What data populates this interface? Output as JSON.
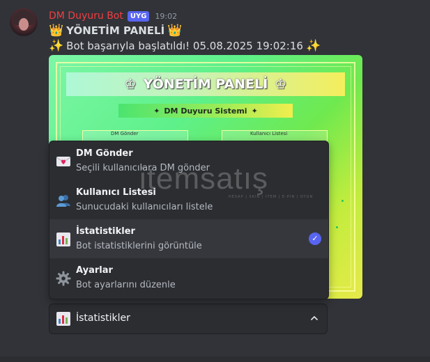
{
  "message": {
    "username": "DM Duyuru Bot",
    "badge": "UYG",
    "timestamp": "19:02",
    "line1": "YÖNETİM PANELİ",
    "line2": "Bot başarıyla başlatıldı! 05.08.2025 19:02:16"
  },
  "embed_image": {
    "title": "YÖNETİM PANELİ",
    "subtitle": "DM Duyuru Sistemi",
    "box_left": "DM Gönder",
    "box_right": "Kullanıcı Listesi"
  },
  "menu": {
    "options": [
      {
        "label": "DM Gönder",
        "description": "Seçili kullanıcılara DM gönder",
        "icon": "love-letter-icon",
        "selected": false
      },
      {
        "label": "Kullanıcı Listesi",
        "description": "Sunucudaki kullanıcıları listele",
        "icon": "users-icon",
        "selected": false
      },
      {
        "label": "İstatistikler",
        "description": "Bot istatistiklerini görüntüle",
        "icon": "bar-chart-icon",
        "selected": true
      },
      {
        "label": "Ayarlar",
        "description": "Bot ayarlarını düzenle",
        "icon": "gear-icon",
        "selected": false
      }
    ]
  },
  "select": {
    "value": "İstatistikler",
    "icon": "bar-chart-icon"
  },
  "watermark": {
    "text": "itemsatış",
    "sub": "HESAP | SKIN | ITEM | E-PIN | OYUN"
  },
  "colors": {
    "background": "#313338",
    "username": "#f23f43",
    "badge": "#5865f2",
    "menu_bg": "#2b2d31",
    "selected_bg": "#36373d",
    "check": "#5865f2"
  }
}
